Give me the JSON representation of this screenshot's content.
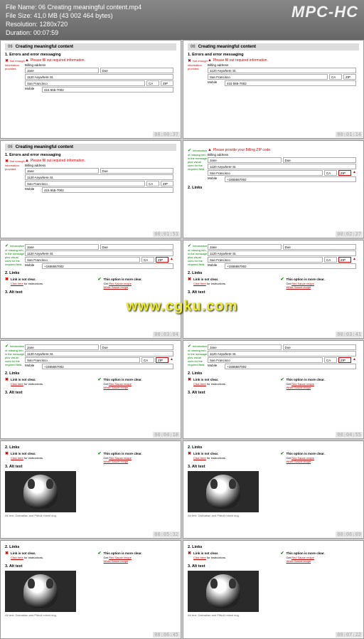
{
  "header": {
    "filename_label": "File Name:",
    "filename": "06 Creating meaningful content.mp4",
    "filesize_label": "File Size:",
    "filesize": "41,0 MB (43 002 464 bytes)",
    "resolution_label": "Resolution:",
    "resolution": "1280x720",
    "duration_label": "Duration:",
    "duration": "00:07:59",
    "logo": "MPC-HC"
  },
  "watermark": "www.cgku.com",
  "slide": {
    "num": "06",
    "title": "Creating meaningful content",
    "sec1": "1. Errors and error messaging",
    "sec2": "2. Links",
    "sec3": "3. Alt text",
    "err_fill": "Please fill out required information.",
    "err_zip": "Please provide your Billing ZIP code.",
    "note_red": "Not enough information provided.",
    "note_green": "Information of missing info, in the message plus visual cues for the required field.",
    "billing": "Billing address",
    "fname": "Jane",
    "lname": "Doe",
    "addr": "1120 Anywhere St.",
    "city": "San Francisco",
    "state": "CA",
    "zip": "ZIP",
    "mobile_lbl": "Mobile",
    "mobile_a": "415 555-7002",
    "mobile_b": "+1555557002",
    "link_bad": "Link is not clear.",
    "link_good": "This option is more clear.",
    "link_bad_body_a": "Click here",
    "link_bad_body_b": "for instructions.",
    "link_good_body_pre": "Get",
    "link_good_a": "Red Sauce recipe",
    "link_good_b": "White Sauce recipe",
    "alt_caption": "Alt text: Dalmatian and Pitbull mixed dog."
  },
  "ts": [
    "00:00:37",
    "00:01:14",
    "00:01:51",
    "00:02:27",
    "00:03:04",
    "00:03:41",
    "00:04:18",
    "00:04:55",
    "00:05:32",
    "00:06:09",
    "00:06:45",
    "00:07:22"
  ]
}
